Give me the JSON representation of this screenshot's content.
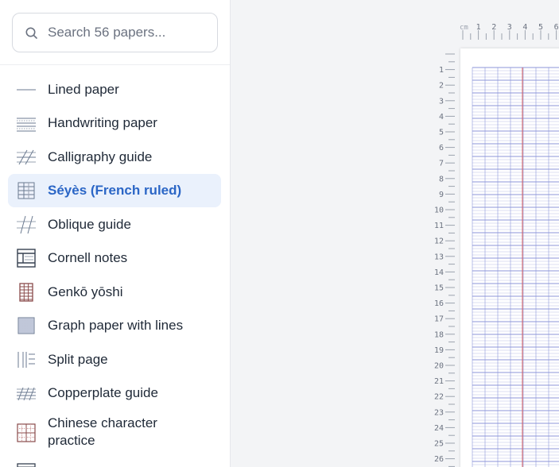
{
  "search": {
    "placeholder": "Search 56 papers..."
  },
  "papers": [
    {
      "label": "Lined paper",
      "icon": "lined-paper-icon",
      "active": false
    },
    {
      "label": "Handwriting paper",
      "icon": "handwriting-paper-icon",
      "active": false
    },
    {
      "label": "Calligraphy guide",
      "icon": "calligraphy-guide-icon",
      "active": false
    },
    {
      "label": "Séyès (French ruled)",
      "icon": "seyes-ruled-icon",
      "active": true
    },
    {
      "label": "Oblique guide",
      "icon": "oblique-guide-icon",
      "active": false
    },
    {
      "label": "Cornell notes",
      "icon": "cornell-notes-icon",
      "active": false
    },
    {
      "label": "Genkō yōshi",
      "icon": "genko-yoshi-icon",
      "active": false
    },
    {
      "label": "Graph paper with lines",
      "icon": "graph-paper-icon",
      "active": false
    },
    {
      "label": "Split page",
      "icon": "split-page-icon",
      "active": false
    },
    {
      "label": "Copperplate guide",
      "icon": "copperplate-guide-icon",
      "active": false
    },
    {
      "label": "Chinese character practice",
      "icon": "chinese-character-practice-icon",
      "active": false
    }
  ],
  "ruler": {
    "unit": "cm",
    "top_ticks": [
      "1",
      "2",
      "3",
      "4",
      "5",
      "6"
    ],
    "left_ticks": [
      "1",
      "2",
      "3",
      "4",
      "5",
      "6",
      "7",
      "8",
      "9",
      "10",
      "11",
      "12",
      "13",
      "14",
      "15",
      "16",
      "17",
      "18",
      "19",
      "20",
      "21",
      "22",
      "23",
      "24",
      "25",
      "26"
    ]
  },
  "colors": {
    "accent": "#2b66c6",
    "active_bg": "#eaf1fc",
    "grid_line": "#b9bfe6",
    "margin_line": "#d95b5b"
  }
}
